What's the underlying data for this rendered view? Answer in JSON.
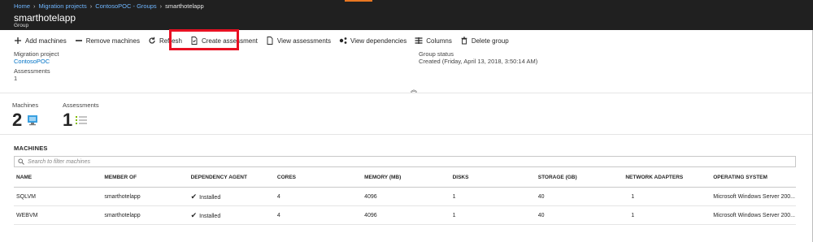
{
  "header": {
    "breadcrumb": [
      "Home",
      "Migration projects",
      "ContosoPOC - Groups",
      "smarthotelapp"
    ],
    "title": "smarthotelapp",
    "subtitle": "Group"
  },
  "toolbar": {
    "add_machines": "Add machines",
    "remove_machines": "Remove machines",
    "refresh": "Refresh",
    "create_assessment": "Create assessment",
    "view_assessments": "View assessments",
    "view_dependencies": "View dependencies",
    "columns": "Columns",
    "delete_group": "Delete group"
  },
  "essentials": {
    "migration_project_label": "Migration project",
    "migration_project_value": "ContosoPOC",
    "assessments_label": "Assessments",
    "assessments_value": "1",
    "group_status_label": "Group status",
    "group_status_value": "Created (Friday, April 13, 2018, 3:50:14 AM)"
  },
  "tiles": {
    "machines_label": "Machines",
    "machines_count": "2",
    "assessments_label": "Assessments",
    "assessments_count": "1"
  },
  "machines": {
    "title": "MACHINES",
    "filter_placeholder": "Search to filter machines",
    "columns": [
      "NAME",
      "MEMBER OF",
      "DEPENDENCY AGENT",
      "CORES",
      "MEMORY (MB)",
      "DISKS",
      "STORAGE (GB)",
      "NETWORK ADAPTERS",
      "OPERATING SYSTEM"
    ],
    "rows": [
      {
        "name": "SQLVM",
        "member_of": "smarthotelapp",
        "agent": "Installed",
        "cores": "4",
        "memory": "4096",
        "disks": "1",
        "storage": "40",
        "adapters": "1",
        "os": "Microsoft Windows Server 200..."
      },
      {
        "name": "WEBVM",
        "member_of": "smarthotelapp",
        "agent": "Installed",
        "cores": "4",
        "memory": "4096",
        "disks": "1",
        "storage": "40",
        "adapters": "1",
        "os": "Microsoft Windows Server 200..."
      }
    ]
  },
  "colors": {
    "accent_link": "#0072c6",
    "highlight": "#e81123",
    "topbar": "#202020"
  }
}
